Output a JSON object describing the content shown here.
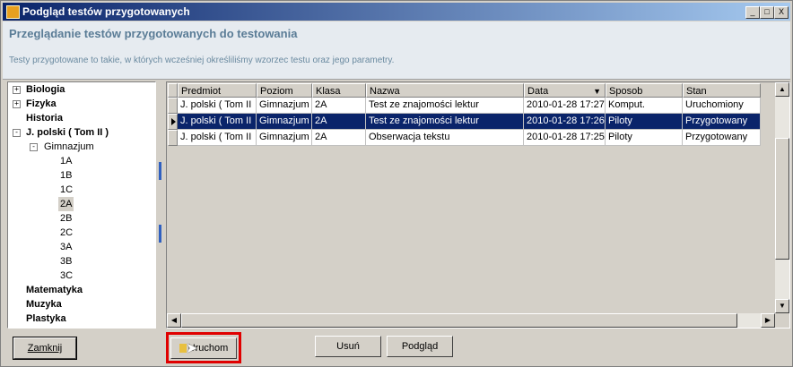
{
  "window": {
    "title": "Podgląd testów przygotowanych",
    "controls": [
      "_",
      "□",
      "X"
    ]
  },
  "header": {
    "title": "Przeglądanie testów przygotowanych do testowania",
    "description": "Testy przygotowane to takie, w których wcześniej określiliśmy wzorzec testu oraz jego parametry."
  },
  "tree": {
    "items": [
      {
        "label": "Biologia",
        "expander": "+"
      },
      {
        "label": "Fizyka",
        "expander": "+"
      },
      {
        "label": "Historia",
        "expander": ""
      },
      {
        "label": "J. polski   ( Tom II )",
        "expander": "-"
      },
      {
        "label": "Gimnazjum",
        "expander": "-"
      },
      {
        "label": "1A"
      },
      {
        "label": "1B"
      },
      {
        "label": "1C"
      },
      {
        "label": "2A",
        "selected": true
      },
      {
        "label": "2B"
      },
      {
        "label": "2C"
      },
      {
        "label": "3A"
      },
      {
        "label": "3B"
      },
      {
        "label": "3C"
      },
      {
        "label": "Matematyka"
      },
      {
        "label": "Muzyka"
      },
      {
        "label": "Plastyka"
      }
    ]
  },
  "grid": {
    "columns": [
      "Predmiot",
      "Poziom",
      "Klasa",
      "Nazwa",
      "Data",
      "Sposob",
      "Stan"
    ],
    "sort_indicator": "▼",
    "rows": [
      [
        "J. polski   ( Tom II",
        "Gimnazjum",
        "2A",
        "Test ze znajomości lektur",
        "2010-01-28 17:27",
        "Komput.",
        "Uruchomiony"
      ],
      [
        "J. polski   ( Tom II",
        "Gimnazjum",
        "2A",
        "Test ze znajomości lektur",
        "2010-01-28 17:26",
        "Piloty",
        "Przygotowany"
      ],
      [
        "J. polski   ( Tom II",
        "Gimnazjum",
        "2A",
        "Obserwacja tekstu",
        "2010-01-28 17:25",
        "Piloty",
        "Przygotowany"
      ]
    ],
    "selected_row": 1
  },
  "buttons": {
    "close": "Zamknij",
    "run": "Uruchom",
    "delete": "Usuń",
    "preview": "Podgląd"
  },
  "colors": {
    "selection": "#0a246a",
    "highlight": "#e00000",
    "header_text": "#5a7c96"
  }
}
